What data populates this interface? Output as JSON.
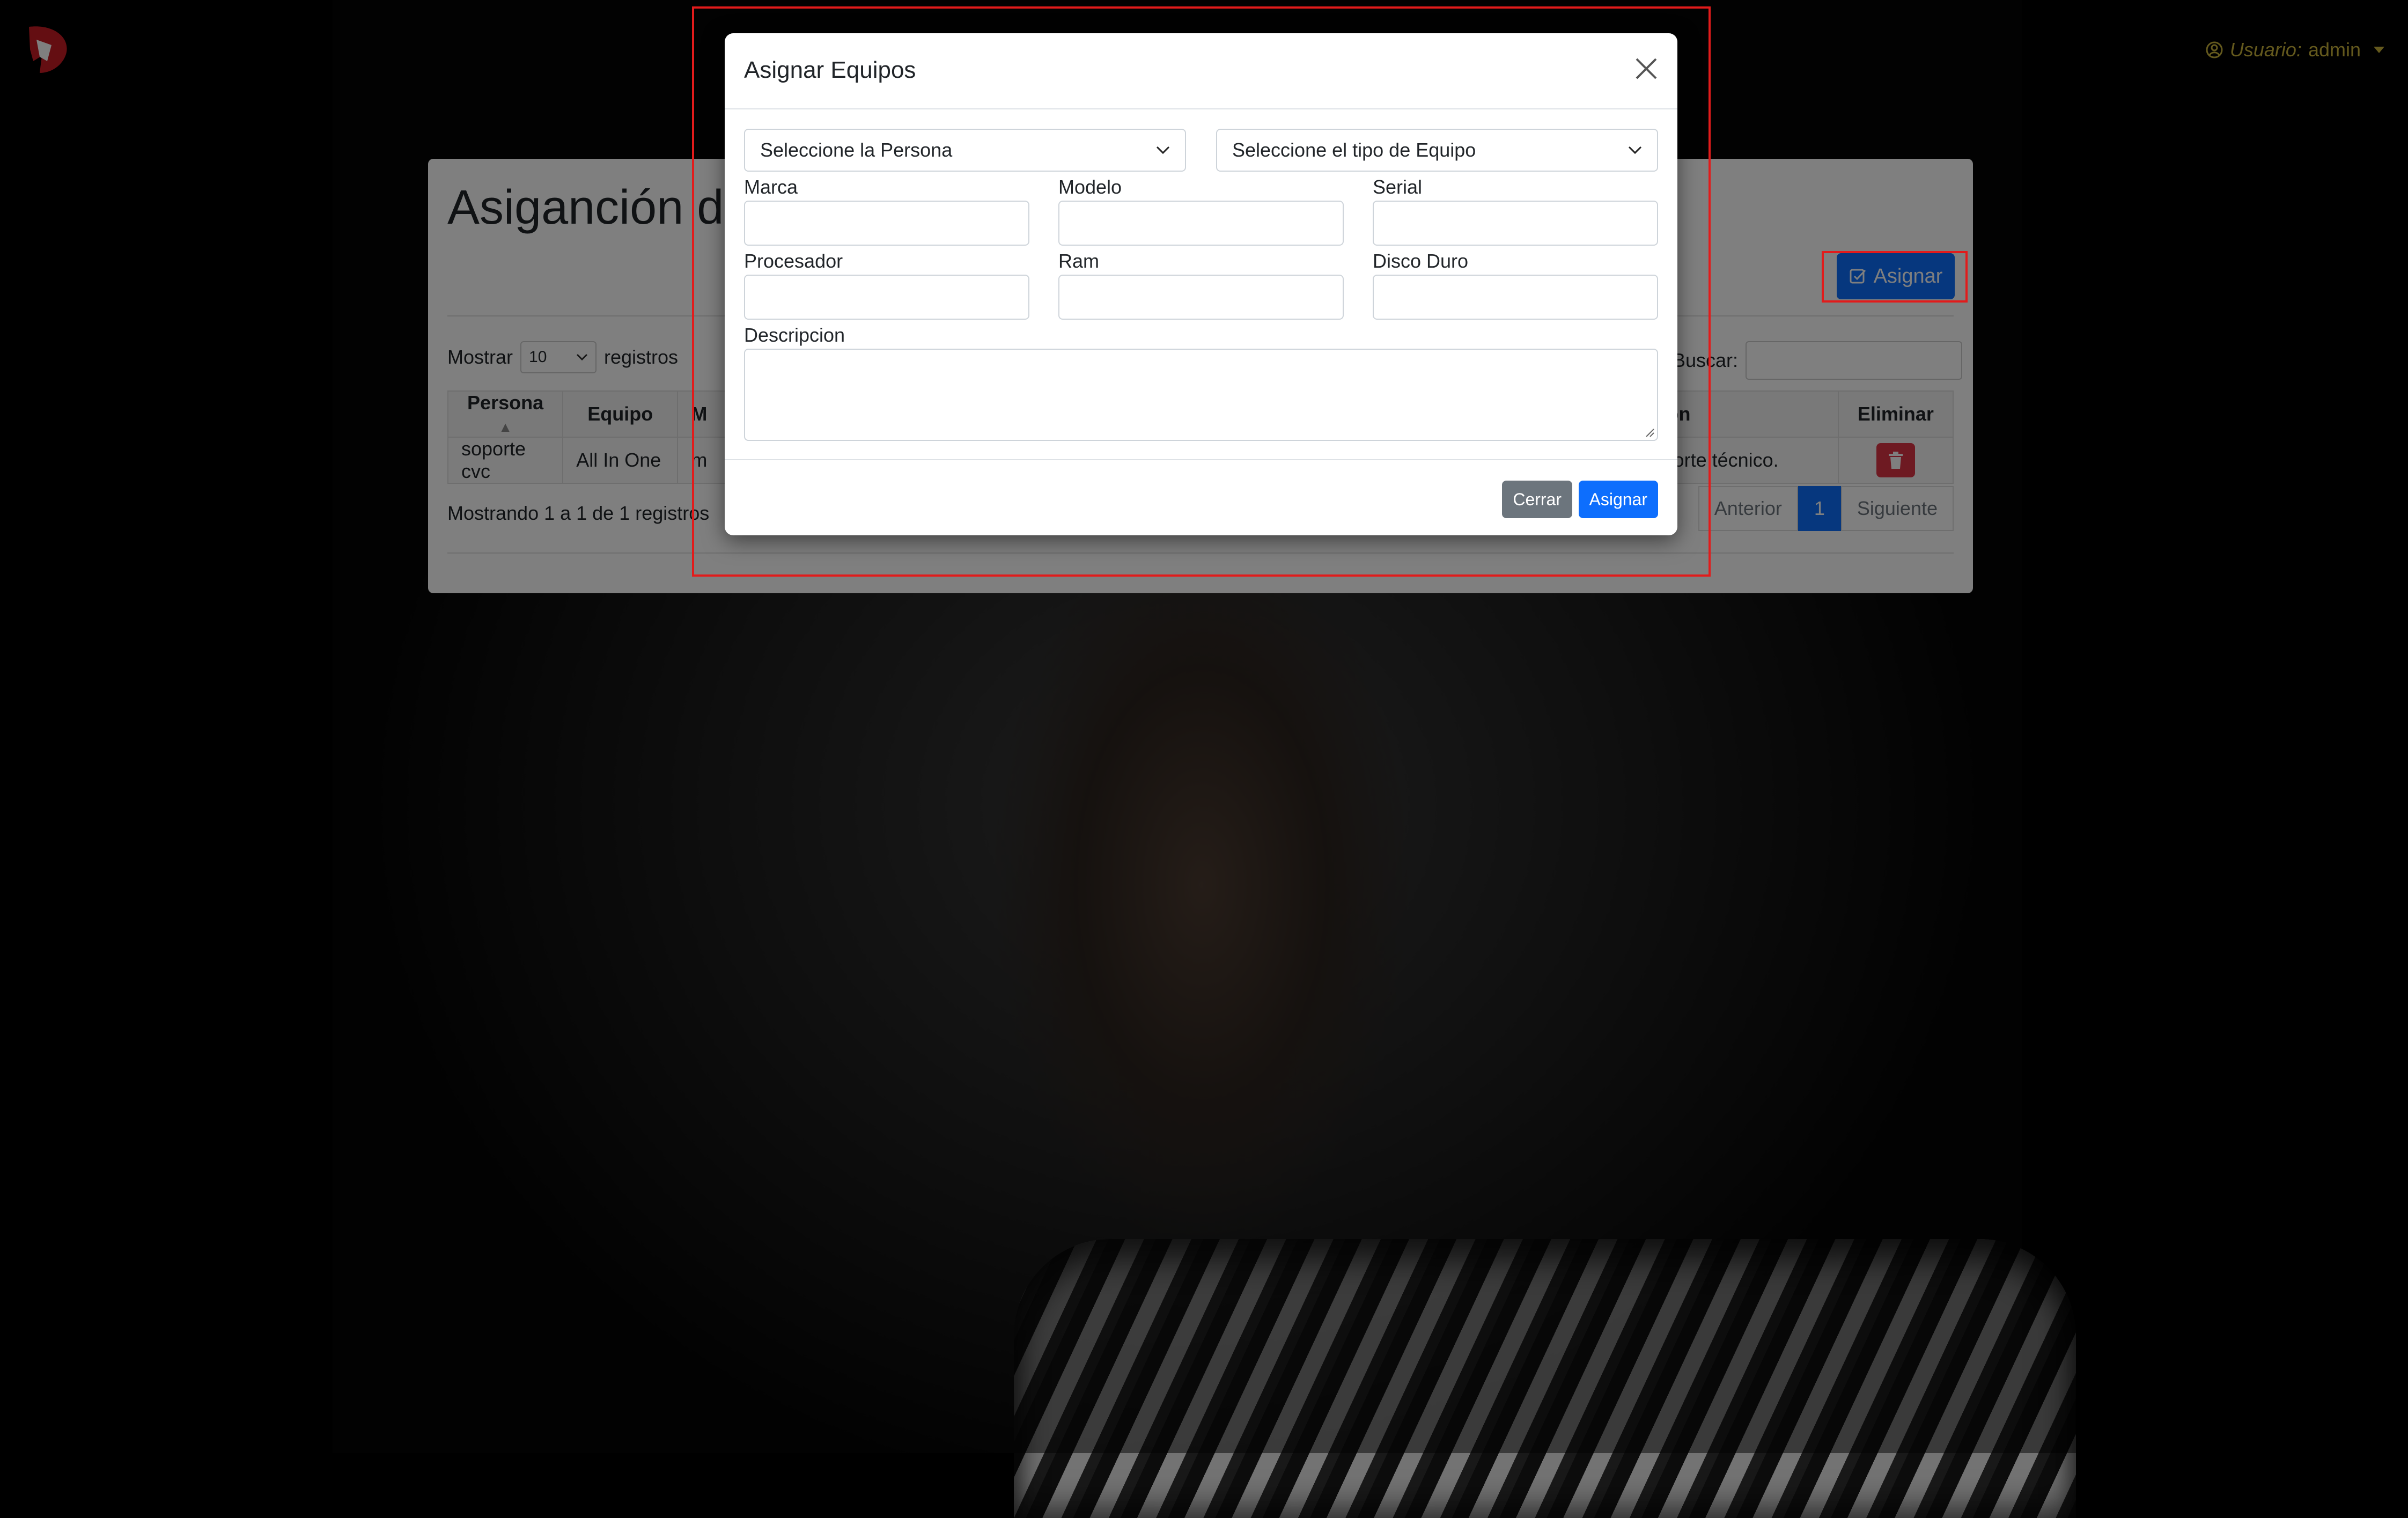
{
  "topbar": {
    "user_label": "Usuario:",
    "user_name": "admin"
  },
  "page": {
    "title": "Asiganción de",
    "assign_button": "Asignar",
    "length_prefix": "Mostrar",
    "length_value": "10",
    "length_suffix": "registros",
    "search_label": "Buscar:",
    "table": {
      "headers": [
        "Persona",
        "Equipo",
        "M",
        "pcion",
        "Eliminar"
      ],
      "rows": [
        [
          "soporte cvc",
          "All In One",
          "m",
          "Soporte técnico."
        ]
      ]
    },
    "info": "Mostrando 1 a 1 de 1 registros",
    "pager": {
      "prev": "Anterior",
      "page": "1",
      "next": "Siguiente"
    }
  },
  "modal": {
    "title": "Asignar Equipos",
    "select_persona": "Seleccione la Persona",
    "select_tipo": "Seleccione el tipo de Equipo",
    "labels": {
      "marca": "Marca",
      "modelo": "Modelo",
      "serial": "Serial",
      "procesador": "Procesador",
      "ram": "Ram",
      "disco": "Disco Duro",
      "descripcion": "Descripcion"
    },
    "btn_close": "Cerrar",
    "btn_assign": "Asignar"
  },
  "colors": {
    "primary": "#0d6efd",
    "secondary": "#6c757d",
    "danger": "#dc3545",
    "user_accent": "#c8b23a",
    "highlight": "#e21b1b"
  }
}
